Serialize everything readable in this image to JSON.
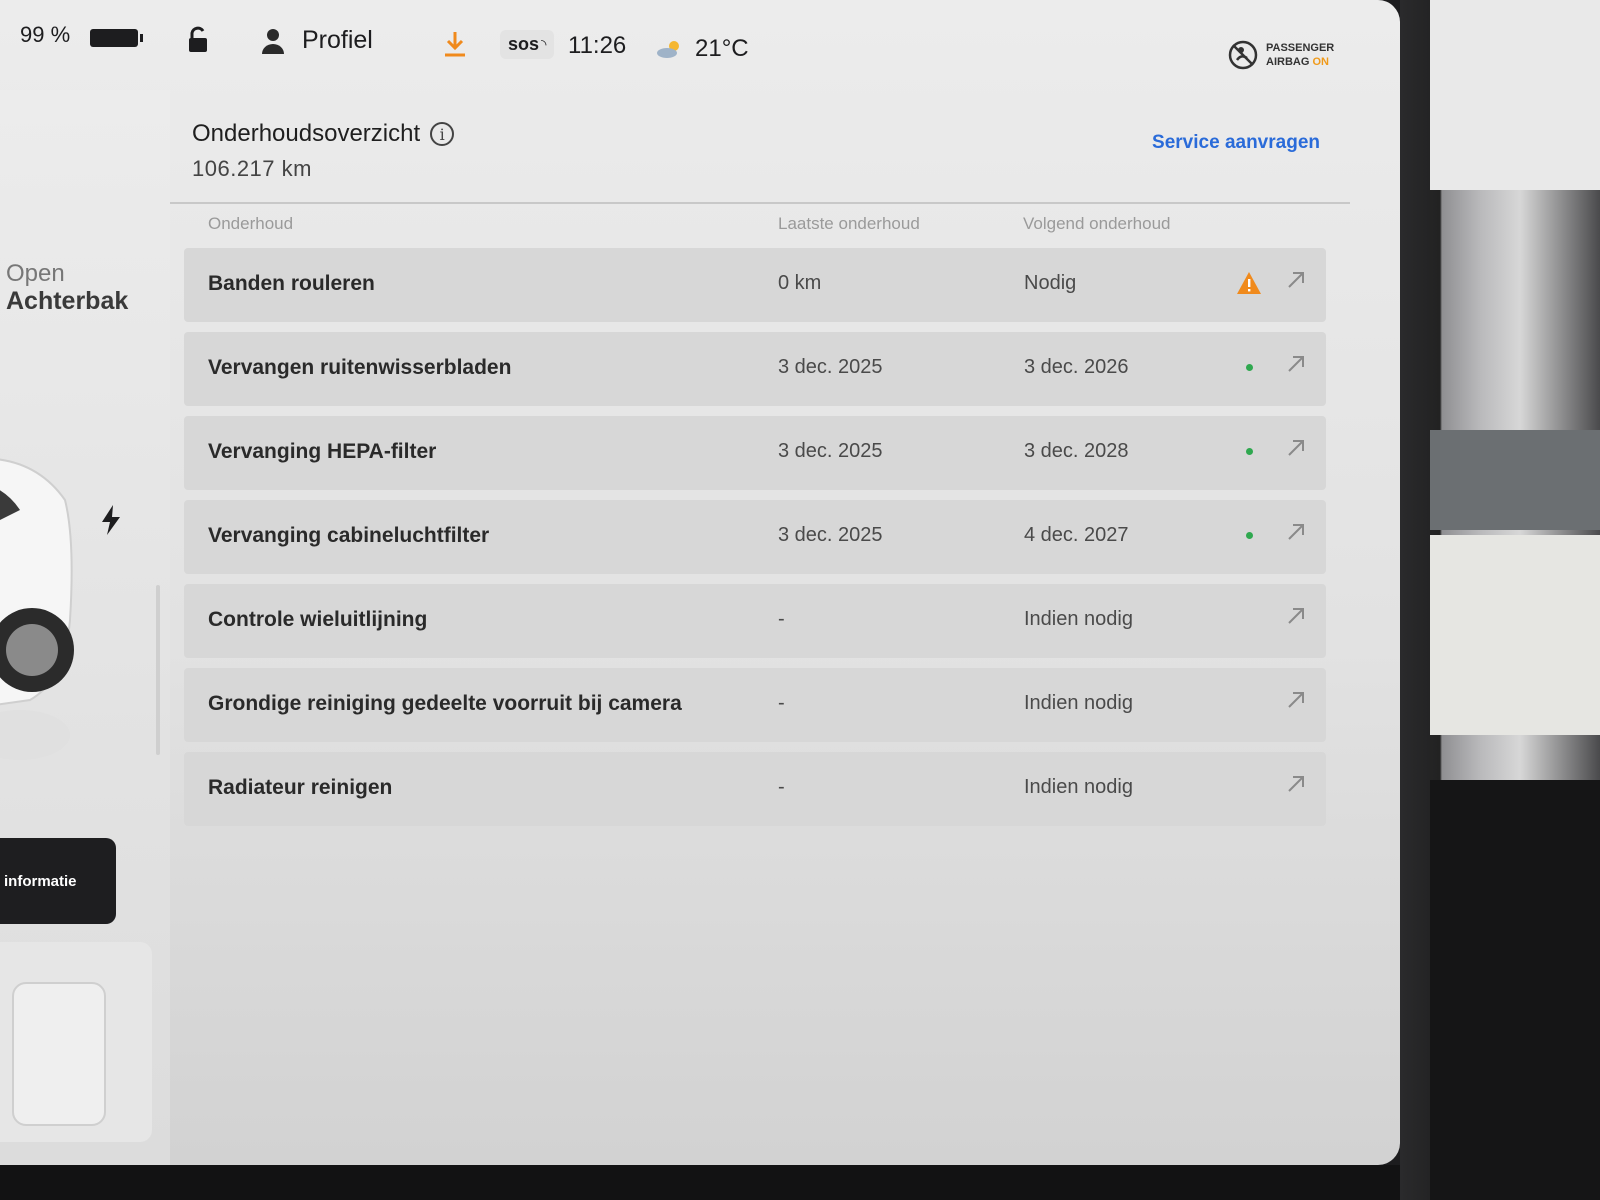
{
  "status_bar": {
    "battery_percent": "99 %",
    "battery_level": 0.99,
    "profile_label": "Profiel",
    "sos_label": "sos",
    "time": "11:26",
    "temperature": "21°C",
    "airbag_line1": "PASSENGER",
    "airbag_line2": "AIRBAG",
    "airbag_state": "ON"
  },
  "left_panel": {
    "trunk_action": "Open",
    "trunk_label": "Achterbak",
    "info_button_label": "informatie"
  },
  "maintenance": {
    "title": "Onderhoudsoverzicht",
    "odometer": "106.217  km",
    "service_link": "Service aanvragen",
    "columns": {
      "task": "Onderhoud",
      "last": "Laatste onderhoud",
      "next": "Volgend onderhoud"
    },
    "rows": [
      {
        "task": "Banden rouleren",
        "last": "0 km",
        "next": "Nodig",
        "status": "warning"
      },
      {
        "task": "Vervangen ruitenwisserbladen",
        "last": "3 dec. 2025",
        "next": "3 dec. 2026",
        "status": "ok"
      },
      {
        "task": "Vervanging HEPA-filter",
        "last": "3 dec. 2025",
        "next": "3 dec. 2028",
        "status": "ok"
      },
      {
        "task": "Vervanging cabineluchtfilter",
        "last": "3 dec. 2025",
        "next": "4 dec. 2027",
        "status": "ok"
      },
      {
        "task": "Controle wieluitlijning",
        "last": "-",
        "next": "Indien nodig",
        "status": "none"
      },
      {
        "task": "Grondige reiniging gedeelte voorruit bij camera",
        "last": "-",
        "next": "Indien nodig",
        "status": "none"
      },
      {
        "task": "Radiateur reinigen",
        "last": "-",
        "next": "Indien nodig",
        "status": "none"
      }
    ]
  },
  "colors": {
    "accent_link": "#2a6bd9",
    "warning": "#f08a1c",
    "ok": "#2fa84f"
  },
  "icons": {
    "lock": "unlock-icon",
    "profile": "person-icon",
    "download": "download-icon",
    "weather": "cloud-sun-icon",
    "airbag": "airbag-off-icon",
    "row_action": "external-arrow-icon"
  }
}
